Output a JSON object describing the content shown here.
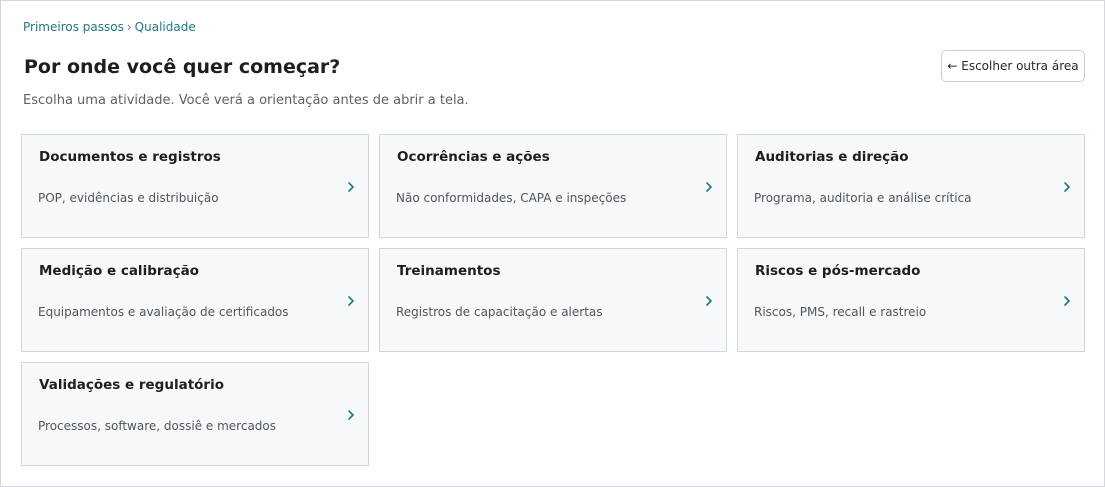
{
  "breadcrumb": {
    "items": [
      "Primeiros passos",
      "Qualidade"
    ],
    "separator": "›"
  },
  "header": {
    "title": "Por onde você quer começar?",
    "back_button_label": "← Escolher outra área",
    "subtitle": "Escolha uma atividade. Você verá a orientação antes de abrir a tela."
  },
  "cards": [
    {
      "title": "Documentos e registros",
      "description": "POP, evidências e distribuição"
    },
    {
      "title": "Ocorrências e ações",
      "description": "Não conformidades, CAPA e inspeções"
    },
    {
      "title": "Auditorias e direção",
      "description": "Programa, auditoria e análise crítica"
    },
    {
      "title": "Medição e calibração",
      "description": "Equipamentos e avaliação de certificados"
    },
    {
      "title": "Treinamentos",
      "description": "Registros de capacitação e alertas"
    },
    {
      "title": "Riscos e pós-mercado",
      "description": "Riscos, PMS, recall e rastreio"
    },
    {
      "title": "Validações e regulatório",
      "description": "Processos, software, dossiê e mercados"
    }
  ],
  "icons": {
    "card_chevron": "chevron-right-icon"
  },
  "colors": {
    "accent": "#1e7a82",
    "card_background": "#f6f8fa",
    "card_border": "#cfd6dc"
  }
}
